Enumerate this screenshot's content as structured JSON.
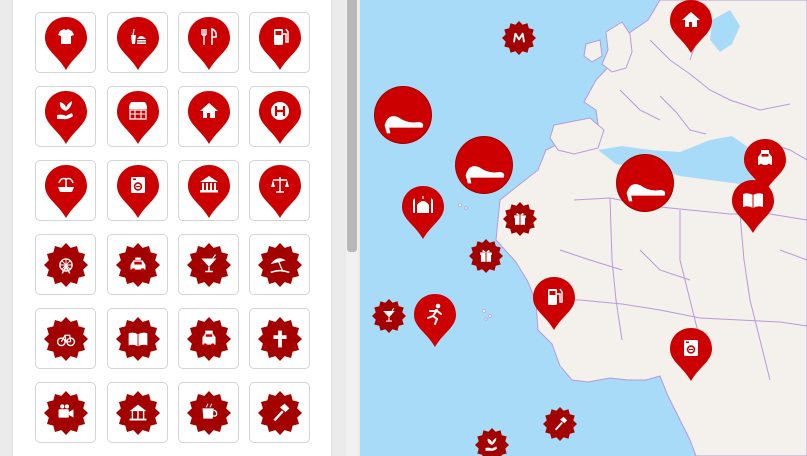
{
  "colors": {
    "marker": "#cc0000",
    "marker_dark": "#a30000",
    "ocean": "#a8dbf7",
    "land": "#f4f1ec",
    "border": "#b79ad9"
  },
  "icon_grid": {
    "rows": [
      [
        {
          "shape": "pin",
          "icon": "tshirt-icon"
        },
        {
          "shape": "pin",
          "icon": "fast-food-icon"
        },
        {
          "shape": "pin",
          "icon": "restaurant-icon"
        },
        {
          "shape": "pin",
          "icon": "fuel-station-icon"
        }
      ],
      [
        {
          "shape": "pin",
          "icon": "plant-hand-icon"
        },
        {
          "shape": "pin",
          "icon": "market-stall-icon"
        },
        {
          "shape": "pin",
          "icon": "home-icon"
        },
        {
          "shape": "pin",
          "icon": "hospital-icon"
        }
      ],
      [
        {
          "shape": "pin",
          "icon": "fountain-icon"
        },
        {
          "shape": "pin",
          "icon": "laundry-icon"
        },
        {
          "shape": "pin",
          "icon": "museum-icon"
        },
        {
          "shape": "pin",
          "icon": "justice-scale-icon"
        }
      ],
      [
        {
          "shape": "starburst",
          "icon": "ferris-wheel-icon"
        },
        {
          "shape": "starburst",
          "icon": "taxi-icon"
        },
        {
          "shape": "starburst",
          "icon": "cocktail-icon"
        },
        {
          "shape": "starburst",
          "icon": "beach-umbrella-icon"
        }
      ],
      [
        {
          "shape": "starburst",
          "icon": "bicycle-icon"
        },
        {
          "shape": "starburst",
          "icon": "open-book-icon"
        },
        {
          "shape": "starburst",
          "icon": "car-rental-icon"
        },
        {
          "shape": "starburst",
          "icon": "church-cross-icon"
        }
      ],
      [
        {
          "shape": "starburst",
          "icon": "video-camera-icon"
        },
        {
          "shape": "starburst",
          "icon": "carousel-icon"
        },
        {
          "shape": "starburst",
          "icon": "coffee-cup-icon"
        },
        {
          "shape": "starburst",
          "icon": "hammer-icon"
        }
      ]
    ]
  },
  "map_markers": [
    {
      "name": "map-marker-home",
      "shape": "pin",
      "icon": "home-icon"
    },
    {
      "name": "map-marker-metro",
      "shape": "starburst",
      "icon": "metro-m-icon",
      "label": "M"
    },
    {
      "name": "map-marker-shoe-1",
      "shape": "circle",
      "icon": "high-heel-icon"
    },
    {
      "name": "map-marker-shoe-2",
      "shape": "circle",
      "icon": "high-heel-icon"
    },
    {
      "name": "map-marker-shoe-3",
      "shape": "circle",
      "icon": "high-heel-icon"
    },
    {
      "name": "map-marker-mosque",
      "shape": "pin",
      "icon": "mosque-icon"
    },
    {
      "name": "map-marker-gift-1",
      "shape": "starburst",
      "icon": "gift-icon"
    },
    {
      "name": "map-marker-gift-2",
      "shape": "starburst",
      "icon": "gift-icon"
    },
    {
      "name": "map-marker-car-rental",
      "shape": "pin",
      "icon": "car-rental-icon"
    },
    {
      "name": "map-marker-book",
      "shape": "pin",
      "icon": "open-book-icon"
    },
    {
      "name": "map-marker-fuel",
      "shape": "pin",
      "icon": "fuel-station-icon"
    },
    {
      "name": "map-marker-runner",
      "shape": "pin",
      "icon": "running-icon"
    },
    {
      "name": "map-marker-cocktail",
      "shape": "starburst",
      "icon": "cocktail-icon"
    },
    {
      "name": "map-marker-laundry",
      "shape": "pin",
      "icon": "laundry-icon"
    },
    {
      "name": "map-marker-hammer",
      "shape": "starburst",
      "icon": "hammer-icon"
    },
    {
      "name": "map-marker-plant",
      "shape": "starburst",
      "icon": "plant-hand-icon"
    }
  ]
}
